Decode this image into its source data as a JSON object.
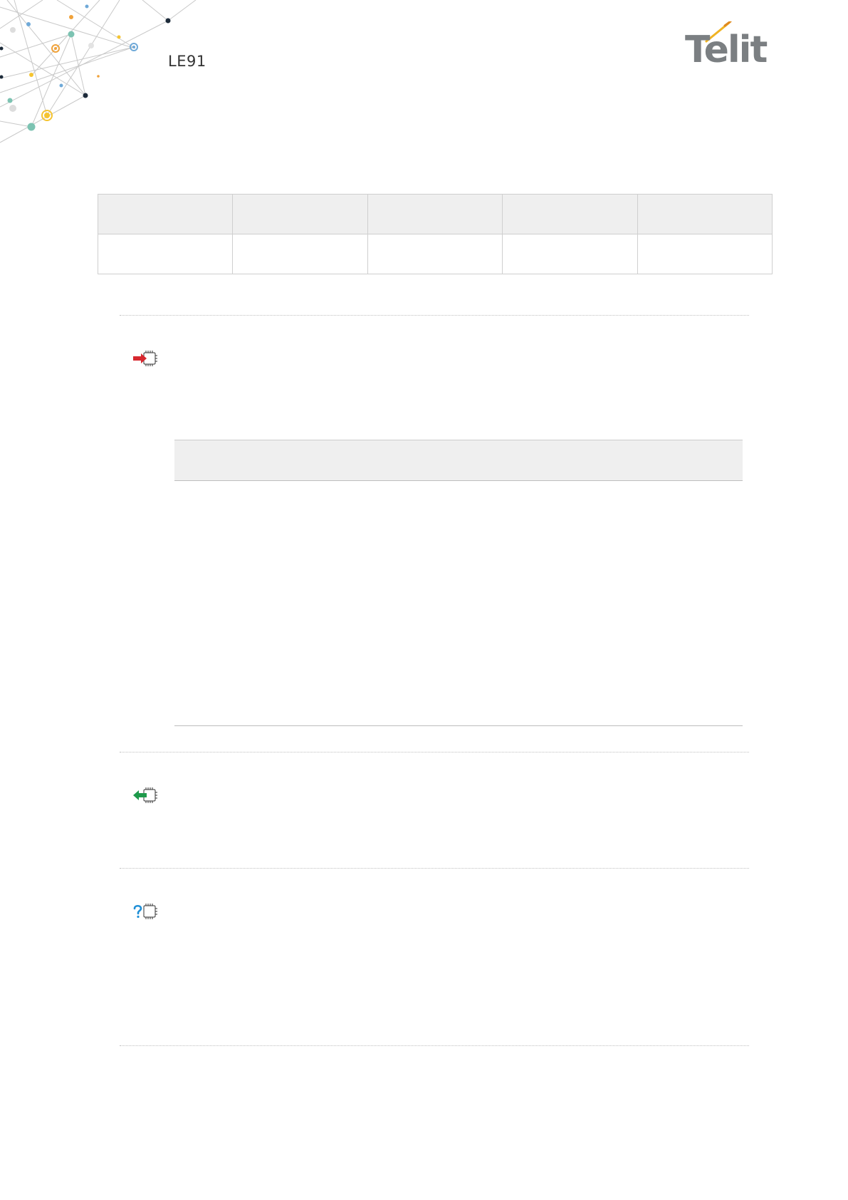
{
  "header": {
    "doc_title": "LE91",
    "logo_text": "Telit",
    "brand_colors": {
      "logo_gray": "#7b7f82",
      "logo_accent": "#f0b323"
    }
  },
  "icons": {
    "set_command": "arrow-into-chip-icon",
    "read_command": "arrow-out-of-chip-icon",
    "test_command": "question-chip-icon"
  },
  "colors": {
    "set_arrow": "#d7282f",
    "read_arrow": "#1e9a4b",
    "test_mark": "#1f8fd6"
  }
}
